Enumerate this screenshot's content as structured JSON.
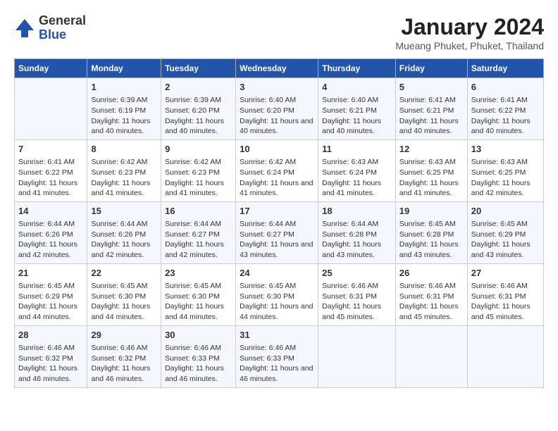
{
  "logo": {
    "general": "General",
    "blue": "Blue"
  },
  "header": {
    "title": "January 2024",
    "subtitle": "Mueang Phuket, Phuket, Thailand"
  },
  "days_of_week": [
    "Sunday",
    "Monday",
    "Tuesday",
    "Wednesday",
    "Thursday",
    "Friday",
    "Saturday"
  ],
  "weeks": [
    [
      {
        "day": "",
        "info": ""
      },
      {
        "day": "1",
        "info": "Sunrise: 6:39 AM\nSunset: 6:19 PM\nDaylight: 11 hours and 40 minutes."
      },
      {
        "day": "2",
        "info": "Sunrise: 6:39 AM\nSunset: 6:20 PM\nDaylight: 11 hours and 40 minutes."
      },
      {
        "day": "3",
        "info": "Sunrise: 6:40 AM\nSunset: 6:20 PM\nDaylight: 11 hours and 40 minutes."
      },
      {
        "day": "4",
        "info": "Sunrise: 6:40 AM\nSunset: 6:21 PM\nDaylight: 11 hours and 40 minutes."
      },
      {
        "day": "5",
        "info": "Sunrise: 6:41 AM\nSunset: 6:21 PM\nDaylight: 11 hours and 40 minutes."
      },
      {
        "day": "6",
        "info": "Sunrise: 6:41 AM\nSunset: 6:22 PM\nDaylight: 11 hours and 40 minutes."
      }
    ],
    [
      {
        "day": "7",
        "info": "Sunrise: 6:41 AM\nSunset: 6:22 PM\nDaylight: 11 hours and 41 minutes."
      },
      {
        "day": "8",
        "info": "Sunrise: 6:42 AM\nSunset: 6:23 PM\nDaylight: 11 hours and 41 minutes."
      },
      {
        "day": "9",
        "info": "Sunrise: 6:42 AM\nSunset: 6:23 PM\nDaylight: 11 hours and 41 minutes."
      },
      {
        "day": "10",
        "info": "Sunrise: 6:42 AM\nSunset: 6:24 PM\nDaylight: 11 hours and 41 minutes."
      },
      {
        "day": "11",
        "info": "Sunrise: 6:43 AM\nSunset: 6:24 PM\nDaylight: 11 hours and 41 minutes."
      },
      {
        "day": "12",
        "info": "Sunrise: 6:43 AM\nSunset: 6:25 PM\nDaylight: 11 hours and 41 minutes."
      },
      {
        "day": "13",
        "info": "Sunrise: 6:43 AM\nSunset: 6:25 PM\nDaylight: 11 hours and 42 minutes."
      }
    ],
    [
      {
        "day": "14",
        "info": "Sunrise: 6:44 AM\nSunset: 6:26 PM\nDaylight: 11 hours and 42 minutes."
      },
      {
        "day": "15",
        "info": "Sunrise: 6:44 AM\nSunset: 6:26 PM\nDaylight: 11 hours and 42 minutes."
      },
      {
        "day": "16",
        "info": "Sunrise: 6:44 AM\nSunset: 6:27 PM\nDaylight: 11 hours and 42 minutes."
      },
      {
        "day": "17",
        "info": "Sunrise: 6:44 AM\nSunset: 6:27 PM\nDaylight: 11 hours and 43 minutes."
      },
      {
        "day": "18",
        "info": "Sunrise: 6:44 AM\nSunset: 6:28 PM\nDaylight: 11 hours and 43 minutes."
      },
      {
        "day": "19",
        "info": "Sunrise: 6:45 AM\nSunset: 6:28 PM\nDaylight: 11 hours and 43 minutes."
      },
      {
        "day": "20",
        "info": "Sunrise: 6:45 AM\nSunset: 6:29 PM\nDaylight: 11 hours and 43 minutes."
      }
    ],
    [
      {
        "day": "21",
        "info": "Sunrise: 6:45 AM\nSunset: 6:29 PM\nDaylight: 11 hours and 44 minutes."
      },
      {
        "day": "22",
        "info": "Sunrise: 6:45 AM\nSunset: 6:30 PM\nDaylight: 11 hours and 44 minutes."
      },
      {
        "day": "23",
        "info": "Sunrise: 6:45 AM\nSunset: 6:30 PM\nDaylight: 11 hours and 44 minutes."
      },
      {
        "day": "24",
        "info": "Sunrise: 6:45 AM\nSunset: 6:30 PM\nDaylight: 11 hours and 44 minutes."
      },
      {
        "day": "25",
        "info": "Sunrise: 6:46 AM\nSunset: 6:31 PM\nDaylight: 11 hours and 45 minutes."
      },
      {
        "day": "26",
        "info": "Sunrise: 6:46 AM\nSunset: 6:31 PM\nDaylight: 11 hours and 45 minutes."
      },
      {
        "day": "27",
        "info": "Sunrise: 6:46 AM\nSunset: 6:31 PM\nDaylight: 11 hours and 45 minutes."
      }
    ],
    [
      {
        "day": "28",
        "info": "Sunrise: 6:46 AM\nSunset: 6:32 PM\nDaylight: 11 hours and 46 minutes."
      },
      {
        "day": "29",
        "info": "Sunrise: 6:46 AM\nSunset: 6:32 PM\nDaylight: 11 hours and 46 minutes."
      },
      {
        "day": "30",
        "info": "Sunrise: 6:46 AM\nSunset: 6:33 PM\nDaylight: 11 hours and 46 minutes."
      },
      {
        "day": "31",
        "info": "Sunrise: 6:46 AM\nSunset: 6:33 PM\nDaylight: 11 hours and 46 minutes."
      },
      {
        "day": "",
        "info": ""
      },
      {
        "day": "",
        "info": ""
      },
      {
        "day": "",
        "info": ""
      }
    ]
  ]
}
